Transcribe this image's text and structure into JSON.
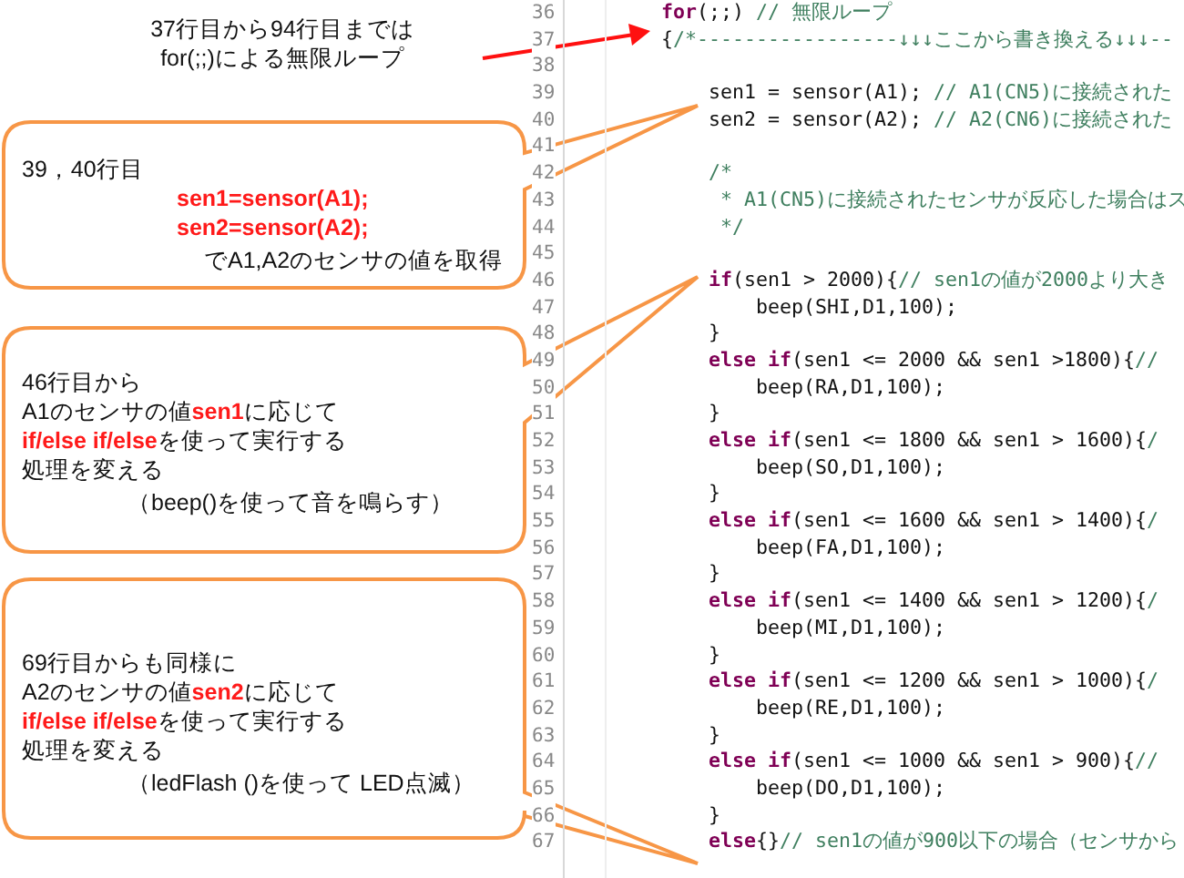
{
  "note": {
    "lines": [
      "37行目から94行目までは",
      "for(;;)による無限ループ"
    ]
  },
  "callouts": [
    {
      "lines": [
        {
          "kind": "plain",
          "text": "39，40行目"
        },
        {
          "kind": "code",
          "text": "sen1=sensor(A1);"
        },
        {
          "kind": "code",
          "text": "sen2=sensor(A2);"
        },
        {
          "kind": "aside",
          "text": "でA1,A2のセンサの値を取得"
        }
      ]
    },
    {
      "lines": [
        {
          "kind": "plain",
          "text": "46行目から"
        },
        {
          "kind": "plain",
          "text": "A1のセンサの値**sen1**に応じて"
        },
        {
          "kind": "plain",
          "text": "**if/else if/else**を使って実行する"
        },
        {
          "kind": "plain",
          "text": "処理を変える"
        },
        {
          "kind": "aside",
          "text": "（beep()を使って音を鳴らす）"
        }
      ]
    },
    {
      "lines": [
        {
          "kind": "plain",
          "text": "69行目からも同様に"
        },
        {
          "kind": "plain",
          "text": "A2のセンサの値**sen2**に応じて"
        },
        {
          "kind": "plain",
          "text": "**if/else if/else**を使って実行する"
        },
        {
          "kind": "plain",
          "text": "処理を変える"
        },
        {
          "kind": "aside",
          "text": "（ledFlash ()を使って LED点滅）"
        }
      ]
    }
  ],
  "editor": {
    "lines": [
      {
        "number": "36",
        "segments": [
          {
            "kind": "keyword",
            "text": "for"
          },
          {
            "kind": "code",
            "text": "(;;) "
          },
          {
            "kind": "comment",
            "text": "// 無限ループ"
          }
        ]
      },
      {
        "number": "37",
        "segments": [
          {
            "kind": "code",
            "text": "{"
          },
          {
            "kind": "comment",
            "text": "/*-----------------↓↓↓ここから書き換える↓↓↓--"
          }
        ]
      },
      {
        "number": "38"
      },
      {
        "number": "39",
        "segments": [
          {
            "kind": "code",
            "text": "    sen1 = sensor(A1); "
          },
          {
            "kind": "comment",
            "text": "// A1(CN5)に接続された"
          }
        ]
      },
      {
        "number": "40",
        "segments": [
          {
            "kind": "code",
            "text": "    sen2 = sensor(A2); "
          },
          {
            "kind": "comment",
            "text": "// A2(CN6)に接続された"
          }
        ]
      },
      {
        "number": "41"
      },
      {
        "number": "42",
        "segments": [
          {
            "kind": "comment",
            "text": "    /*"
          }
        ]
      },
      {
        "number": "43",
        "segments": [
          {
            "kind": "comment",
            "text": "     * A1(CN5)に接続されたセンサが反応した場合はス"
          }
        ]
      },
      {
        "number": "44",
        "segments": [
          {
            "kind": "comment",
            "text": "     */"
          }
        ]
      },
      {
        "number": "45"
      },
      {
        "number": "46",
        "segments": [
          {
            "kind": "keyword",
            "text": "    if"
          },
          {
            "kind": "code",
            "text": "(sen1 > 2000){"
          },
          {
            "kind": "comment",
            "text": "// sen1の値が2000より大き"
          }
        ]
      },
      {
        "number": "47",
        "segments": [
          {
            "kind": "code",
            "text": "        beep(SHI,D1,100);"
          }
        ]
      },
      {
        "number": "48",
        "segments": [
          {
            "kind": "code",
            "text": "    }"
          }
        ]
      },
      {
        "number": "49",
        "segments": [
          {
            "kind": "keyword",
            "text": "    else if"
          },
          {
            "kind": "code",
            "text": "(sen1 <= 2000 && sen1 >1800){"
          },
          {
            "kind": "comment",
            "text": "//"
          }
        ]
      },
      {
        "number": "50",
        "segments": [
          {
            "kind": "code",
            "text": "        beep(RA,D1,100);"
          }
        ]
      },
      {
        "number": "51",
        "segments": [
          {
            "kind": "code",
            "text": "    }"
          }
        ]
      },
      {
        "number": "52",
        "segments": [
          {
            "kind": "keyword",
            "text": "    else if"
          },
          {
            "kind": "code",
            "text": "(sen1 <= 1800 && sen1 > 1600){"
          },
          {
            "kind": "comment",
            "text": "/"
          }
        ]
      },
      {
        "number": "53",
        "segments": [
          {
            "kind": "code",
            "text": "        beep(SO,D1,100);"
          }
        ]
      },
      {
        "number": "54",
        "segments": [
          {
            "kind": "code",
            "text": "    }"
          }
        ]
      },
      {
        "number": "55",
        "segments": [
          {
            "kind": "keyword",
            "text": "    else if"
          },
          {
            "kind": "code",
            "text": "(sen1 <= 1600 && sen1 > 1400){"
          },
          {
            "kind": "comment",
            "text": "/"
          }
        ]
      },
      {
        "number": "56",
        "segments": [
          {
            "kind": "code",
            "text": "        beep(FA,D1,100);"
          }
        ]
      },
      {
        "number": "57",
        "segments": [
          {
            "kind": "code",
            "text": "    }"
          }
        ]
      },
      {
        "number": "58",
        "segments": [
          {
            "kind": "keyword",
            "text": "    else if"
          },
          {
            "kind": "code",
            "text": "(sen1 <= 1400 && sen1 > 1200){"
          },
          {
            "kind": "comment",
            "text": "/"
          }
        ]
      },
      {
        "number": "59",
        "segments": [
          {
            "kind": "code",
            "text": "        beep(MI,D1,100);"
          }
        ]
      },
      {
        "number": "60",
        "segments": [
          {
            "kind": "code",
            "text": "    }"
          }
        ]
      },
      {
        "number": "61",
        "segments": [
          {
            "kind": "keyword",
            "text": "    else if"
          },
          {
            "kind": "code",
            "text": "(sen1 <= 1200 && sen1 > 1000){"
          },
          {
            "kind": "comment",
            "text": "/"
          }
        ]
      },
      {
        "number": "62",
        "segments": [
          {
            "kind": "code",
            "text": "        beep(RE,D1,100);"
          }
        ]
      },
      {
        "number": "63",
        "segments": [
          {
            "kind": "code",
            "text": "    }"
          }
        ]
      },
      {
        "number": "64",
        "segments": [
          {
            "kind": "keyword",
            "text": "    else if"
          },
          {
            "kind": "code",
            "text": "(sen1 <= 1000 && sen1 > 900){"
          },
          {
            "kind": "comment",
            "text": "//"
          }
        ]
      },
      {
        "number": "65",
        "segments": [
          {
            "kind": "code",
            "text": "        beep(DO,D1,100);"
          }
        ]
      },
      {
        "number": "66",
        "segments": [
          {
            "kind": "code",
            "text": "    }"
          }
        ]
      },
      {
        "number": "67",
        "segments": [
          {
            "kind": "keyword",
            "text": "    else"
          },
          {
            "kind": "code",
            "text": "{}"
          },
          {
            "kind": "comment",
            "text": "// sen1の値が900以下の場合（センサから"
          }
        ]
      }
    ]
  }
}
